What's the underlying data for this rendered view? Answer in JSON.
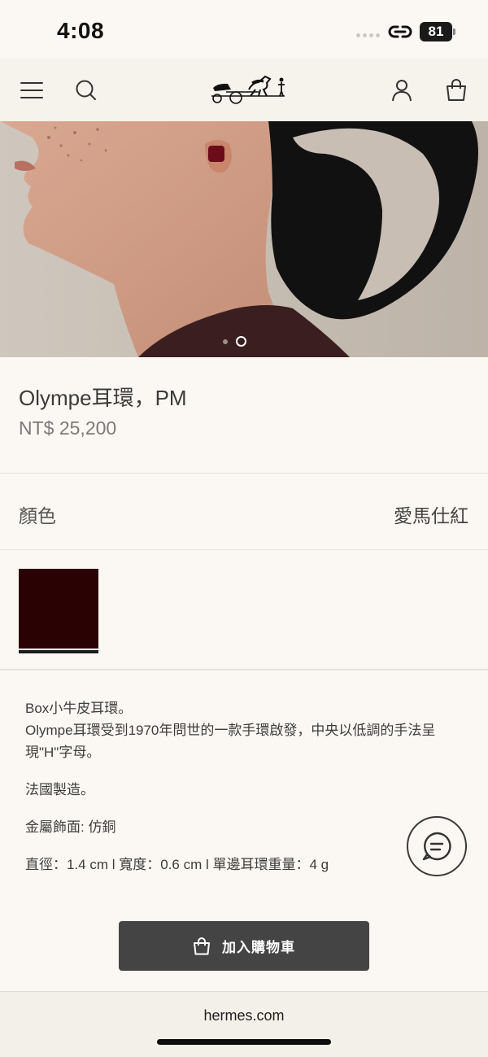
{
  "status_bar": {
    "time": "4:08",
    "battery": "81",
    "icons": [
      "signal-dots-icon",
      "link-icon",
      "battery-icon"
    ]
  },
  "header": {
    "icons": [
      "menu-icon",
      "search-icon",
      "hermes-carriage-logo",
      "account-icon",
      "shopping-bag-icon"
    ]
  },
  "gallery": {
    "image": "woman wearing burgundy hoop earring",
    "total_slides": 2,
    "active_slide": 2
  },
  "product": {
    "name": "Olympe耳環，PM",
    "price": "NT$ 25,200"
  },
  "color": {
    "label": "顏色",
    "value": "愛馬仕紅",
    "swatch_color": "#2a0204"
  },
  "description": {
    "line1": "Box小牛皮耳環。",
    "line2": "Olympe耳環受到1970年問世的一款手環啟發，中央以低調的手法呈現\"H\"字母。",
    "origin": "法國製造。",
    "metal": "金屬飾面: 仿銅",
    "dimensions": "直徑：1.4 cm l 寬度：0.6 cm l 單邊耳環重量：4 g"
  },
  "actions": {
    "add_to_cart": "加入購物車"
  },
  "browser": {
    "url": "hermes.com"
  }
}
